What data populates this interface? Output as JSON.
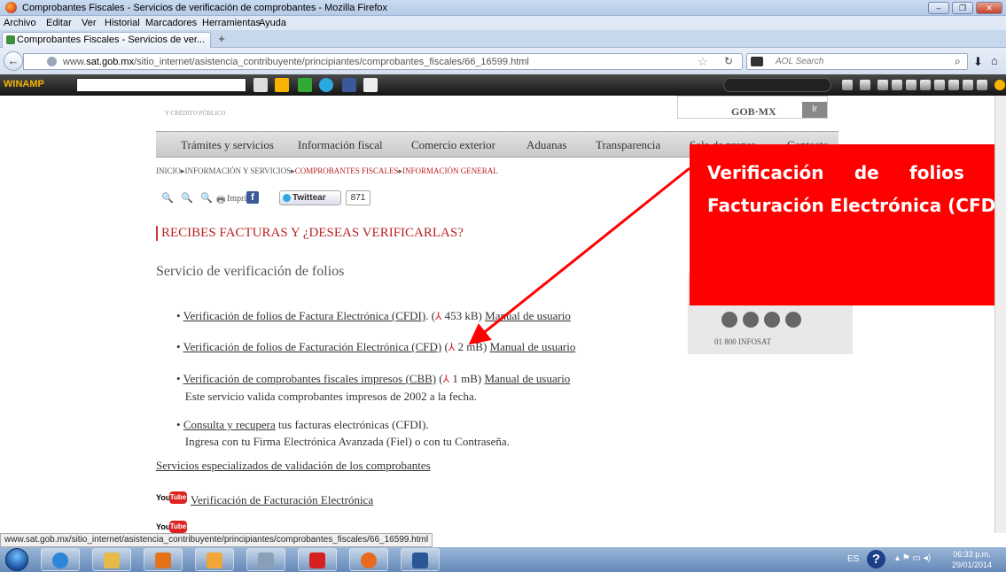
{
  "window": {
    "title": "Comprobantes Fiscales - Servicios de verificación de comprobantes - Mozilla Firefox",
    "minimize": "–",
    "maximize": "❐",
    "close": "✕"
  },
  "menu": [
    "Archivo",
    "Editar",
    "Ver",
    "Historial",
    "Marcadores",
    "Herramientas",
    "Ayuda"
  ],
  "tab": {
    "label": "Comprobantes Fiscales - Servicios de ver...",
    "new_tab": "+"
  },
  "nav": {
    "url_prefix": "www.",
    "url_domain": "sat.gob.mx",
    "url_path": "/sitio_internet/asistencia_contribuyente/principiantes/comprobantes_fiscales/66_16599.html",
    "search_placeholder": "AOL Search"
  },
  "winamp": {
    "label": "WINAMP"
  },
  "site": {
    "gob": "GOB·MX",
    "ir": "Ir",
    "shcp": "Y CRÉDITO PÚBLICO",
    "nav_items": [
      "Trámites y servicios",
      "Información fiscal",
      "Comercio exterior",
      "Aduanas",
      "Transparencia",
      "Sala de prensa",
      "Contacto"
    ],
    "breadcrumb": {
      "a": "INICIO",
      "b": "INFORMACIÓN Y SERVICIOS",
      "c": "COMPROBANTES FISCALES",
      "d": "INFORMACIÓN GENERAL"
    },
    "tools": {
      "imprimir": "Imprimir",
      "twittear": "Twittear",
      "tweet_count": "871"
    },
    "heading": "RECIBES FACTURAS Y ¿DESEAS VERIFICARLAS?",
    "section_title": "Servicio de verificación de folios",
    "items": [
      {
        "link": "Verificación de folios de Factura Electrónica (CFDI)",
        "size": " 453 kB)",
        "manual": "Manual de usuario"
      },
      {
        "link": "Verificación de folios de Facturación Electrónica (CFD)",
        "size": " 2 mB)",
        "manual": "Manual de usuario"
      },
      {
        "link": "Verificación de comprobantes fiscales impresos (CBB)",
        "size": " 1 mB)",
        "manual": "Manual de usuario",
        "note": "Este servicio valida comprobantes impresos de 2002 a la fecha."
      },
      {
        "link": "Consulta y recupera",
        "rest": " tus facturas electrónicas (CFDI).",
        "note": "Ingresa con tu Firma Electrónica Avanzada (Fiel) o con tu Contraseña."
      }
    ],
    "specialized": "Servicios especializados de validación de los comprobantes",
    "youtube": {
      "you": "You",
      "tube": "Tube"
    },
    "video1": "Verificación de Facturación Electrónica",
    "infosat": "01 800 INFOSAT"
  },
  "annotation": {
    "text": "Verificación de folios de Facturación Electrónica (CFD)"
  },
  "status": "www.sat.gob.mx/sitio_internet/asistencia_contribuyente/principiantes/comprobantes_fiscales/66_16599.html",
  "taskbar": {
    "lang": "ES",
    "help": "?",
    "time": "06:33 p.m.",
    "date": "29/01/2014"
  },
  "colors": {
    "annotation": "#ff0000",
    "accent": "#b22222",
    "link": "#333333"
  }
}
